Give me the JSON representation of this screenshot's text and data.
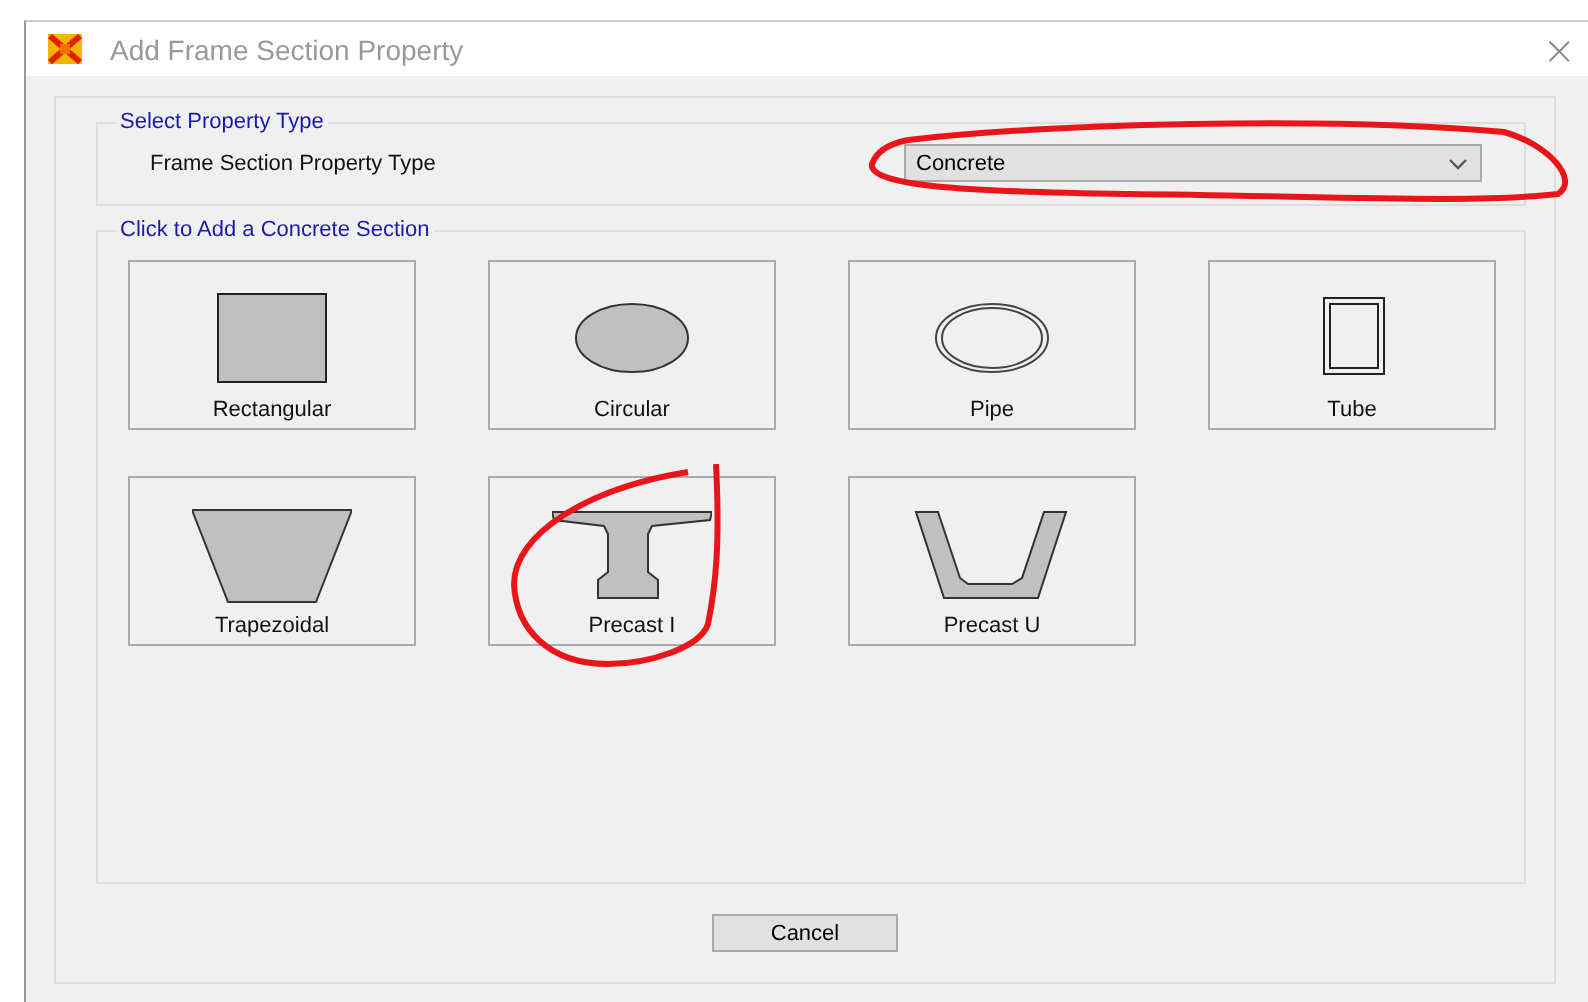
{
  "window": {
    "title": "Add Frame Section Property",
    "close": "×"
  },
  "property_group": {
    "title": "Select Property Type",
    "label": "Frame Section Property Type",
    "value": "Concrete",
    "circled": true
  },
  "sections_group": {
    "title": "Click to Add a Concrete Section",
    "items": [
      {
        "label": "Rectangular",
        "kind": "rectangular",
        "circled": false
      },
      {
        "label": "Circular",
        "kind": "circular",
        "circled": false
      },
      {
        "label": "Pipe",
        "kind": "pipe",
        "circled": false
      },
      {
        "label": "Tube",
        "kind": "tube",
        "circled": false
      },
      {
        "label": "Trapezoidal",
        "kind": "trapezoidal",
        "circled": false
      },
      {
        "label": "Precast I",
        "kind": "precast_i",
        "circled": true
      },
      {
        "label": "Precast U",
        "kind": "precast_u",
        "circled": false
      }
    ]
  },
  "buttons": [
    "Cancel"
  ]
}
